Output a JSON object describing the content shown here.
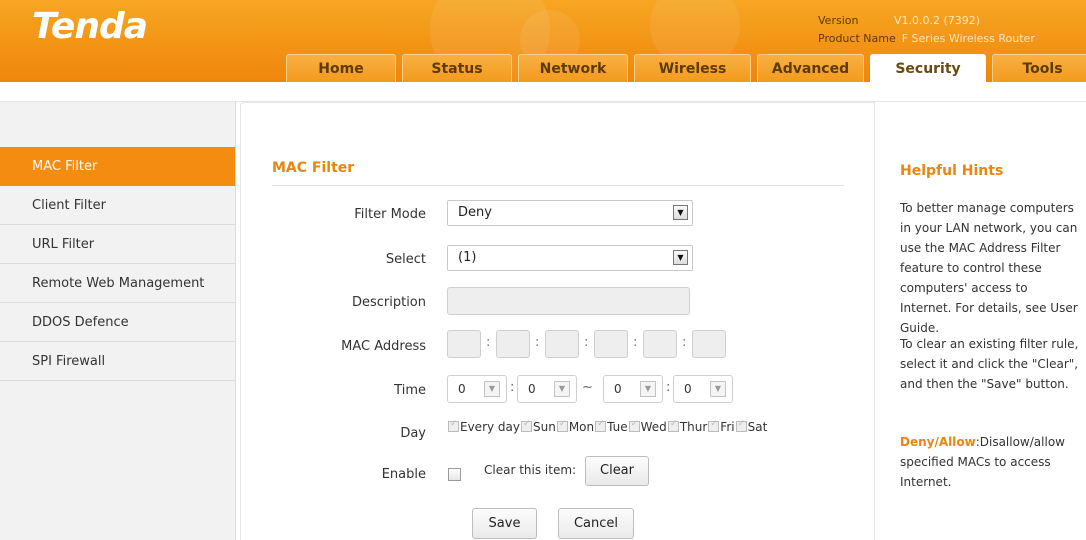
{
  "header": {
    "logo": "Tenda",
    "version_label": "Version",
    "version_value": "V1.0.0.2 (7392)",
    "product_label": "Product Name",
    "product_value": "F Series Wireless Router"
  },
  "tabs": [
    "Home",
    "Status",
    "Network",
    "Wireless",
    "Advanced",
    "Security",
    "Tools"
  ],
  "active_tab": "Security",
  "sidebar": {
    "items": [
      "MAC Filter",
      "Client Filter",
      "URL Filter",
      "Remote Web Management",
      "DDOS Defence",
      "SPI Firewall"
    ],
    "active": "MAC Filter"
  },
  "main": {
    "title": "MAC Filter",
    "filter_mode_label": "Filter Mode",
    "filter_mode_value": "Deny",
    "select_label": "Select",
    "select_value": "(1)",
    "description_label": "Description",
    "description_value": "",
    "mac_label": "MAC Address",
    "mac_sep": ":",
    "time_label": "Time",
    "time_values": [
      "0",
      "0",
      "0",
      "0"
    ],
    "time_range_sep": "~",
    "time_colon": ":",
    "day_label": "Day",
    "days": [
      "Every day",
      "Sun",
      "Mon",
      "Tue",
      "Wed",
      "Thur",
      "Fri",
      "Sat"
    ],
    "enable_label": "Enable",
    "clear_item_label": "Clear this item:",
    "clear_button": "Clear",
    "save_button": "Save",
    "cancel_button": "Cancel"
  },
  "hints": {
    "title": "Helpful Hints",
    "p1": "To better manage computers in your LAN network, you can use the MAC Address Filter feature to control these computers' access to Internet. For details, see User Guide.",
    "p2": "To clear an existing filter rule, select it and click the \"Clear\", and then the \"Save\" button.",
    "p3_strong": "Deny/Allow",
    "p3_text": ":Disallow/allow specified MACs to access Internet."
  },
  "colors": {
    "brand_orange": "#f48c12",
    "hint_orange": "#e98512"
  },
  "icons": [
    "dropdown-arrow-icon",
    "checkbox-icon"
  ]
}
